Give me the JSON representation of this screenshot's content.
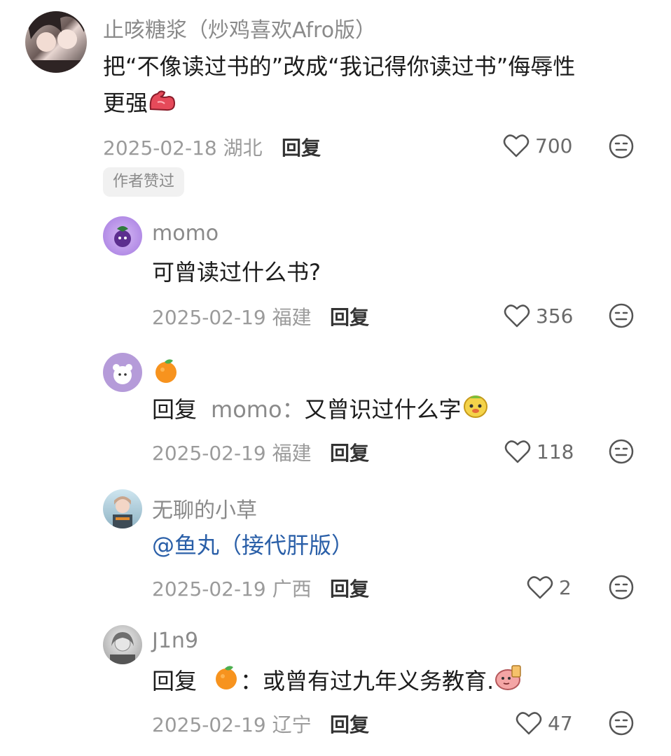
{
  "comments": [
    {
      "username": "止咳糖浆（炒鸡喜欢Afro版）",
      "text_line1": "把“不像读过书的”改成“我记得你读过书”侮辱性",
      "text_line2": "更强",
      "emoji": "flexed-biceps-sticker",
      "date": "2025-02-18",
      "location": "湖北",
      "reply_label": "回复",
      "likes": "700",
      "badge": "作者赞过"
    },
    {
      "username": "momo",
      "text": "可曾读过什么书?",
      "date": "2025-02-19",
      "location": "福建",
      "reply_label": "回复",
      "likes": "356"
    },
    {
      "username_emoji": "tangerine",
      "reply_prefix": "回复",
      "reply_target": "momo：",
      "text": "又曾识过什么字",
      "emoji": "cartoon-face-sticker",
      "date": "2025-02-19",
      "location": "福建",
      "reply_label": "回复",
      "likes": "118"
    },
    {
      "username": "无聊的小草",
      "mention": "@鱼丸（接代肝版）",
      "date": "2025-02-19",
      "location": "广西",
      "reply_label": "回复",
      "likes": "2"
    },
    {
      "username": "J1n9",
      "reply_prefix": "回复",
      "reply_target_emoji": "tangerine",
      "reply_colon": "：",
      "text": "或曾有过九年义务教育.",
      "emoji": "pink-character-sticker",
      "date": "2025-02-19",
      "location": "辽宁",
      "reply_label": "回复",
      "likes": "47"
    }
  ],
  "icons": {
    "like": "heart-outline-icon",
    "more": "meh-face-icon"
  },
  "colors": {
    "text": "#1c1c1c",
    "muted": "#9b9b9b",
    "link": "#2a5fa8",
    "badge_bg": "#f1f1f1"
  }
}
